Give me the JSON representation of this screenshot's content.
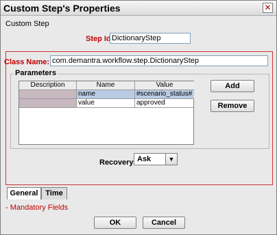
{
  "window": {
    "title": "Custom Step's Properties",
    "close_symbol": "✕",
    "subtitle": "Custom Step"
  },
  "step_id": {
    "label": "Step Id",
    "value": "DictionaryStep"
  },
  "class_name": {
    "label": "Class Name:",
    "value": "com.demantra.workflow.step.DictionaryStep"
  },
  "parameters": {
    "legend": "Parameters",
    "columns": [
      "Description",
      "Name",
      "Value"
    ],
    "rows": [
      {
        "description": "",
        "name": "name",
        "value": "#scenario_status#"
      },
      {
        "description": "",
        "name": "value",
        "value": "approved"
      }
    ],
    "add_label": "Add",
    "remove_label": "Remove"
  },
  "recovery": {
    "label": "Recovery:",
    "selected": "Ask",
    "arrow": "▼"
  },
  "tabs": [
    {
      "label": "General"
    },
    {
      "label": "Time"
    }
  ],
  "mandatory_note": "- Mandatory Fields",
  "footer": {
    "ok_label": "OK",
    "cancel_label": "Cancel"
  }
}
